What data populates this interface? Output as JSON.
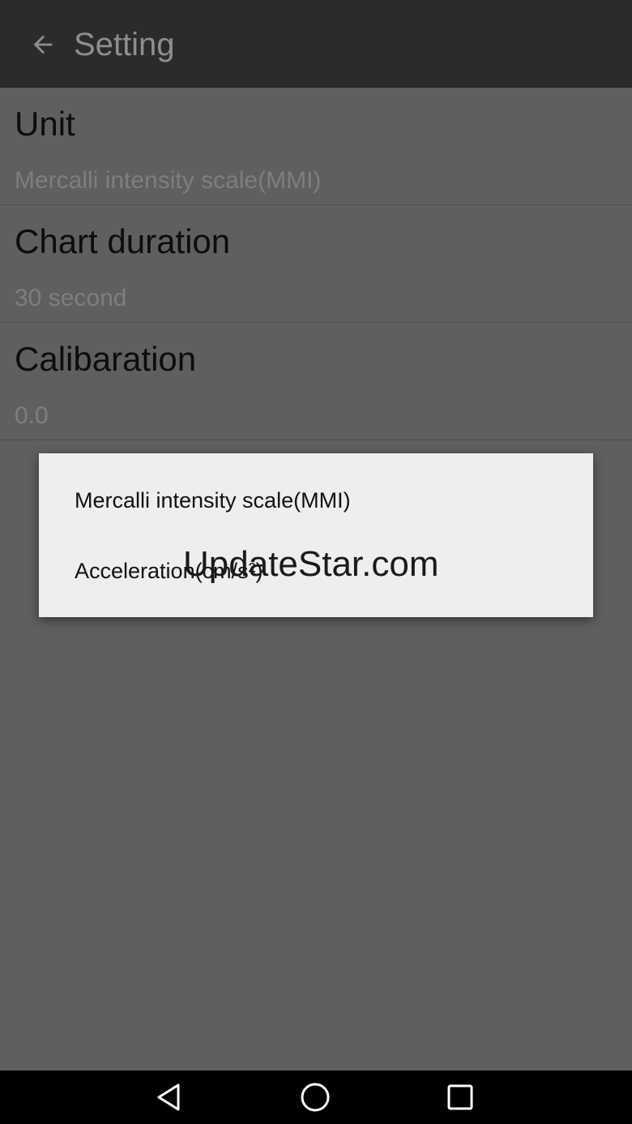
{
  "toolbar": {
    "back_icon": "arrow-left-icon",
    "title": "Setting"
  },
  "preferences": [
    {
      "title": "Unit",
      "summary": "Mercalli intensity scale(MMI)"
    },
    {
      "title": "Chart duration",
      "summary": "30 second"
    },
    {
      "title": "Calibaration",
      "summary": "0.0"
    }
  ],
  "dialog": {
    "options": [
      {
        "label": "Mercalli intensity scale(MMI)"
      },
      {
        "label": "Acceleration(cm/s²)"
      }
    ]
  },
  "watermark": "UpdateStar.com",
  "navbar": {
    "back_icon": "triangle-back-icon",
    "home_icon": "circle-home-icon",
    "recents_icon": "square-recents-icon"
  },
  "colors": {
    "toolbar_bg": "#2b2b2b",
    "scrim_bg": "#5f5f5f",
    "dialog_bg": "#eeeeee",
    "navbar_bg": "#000000"
  }
}
